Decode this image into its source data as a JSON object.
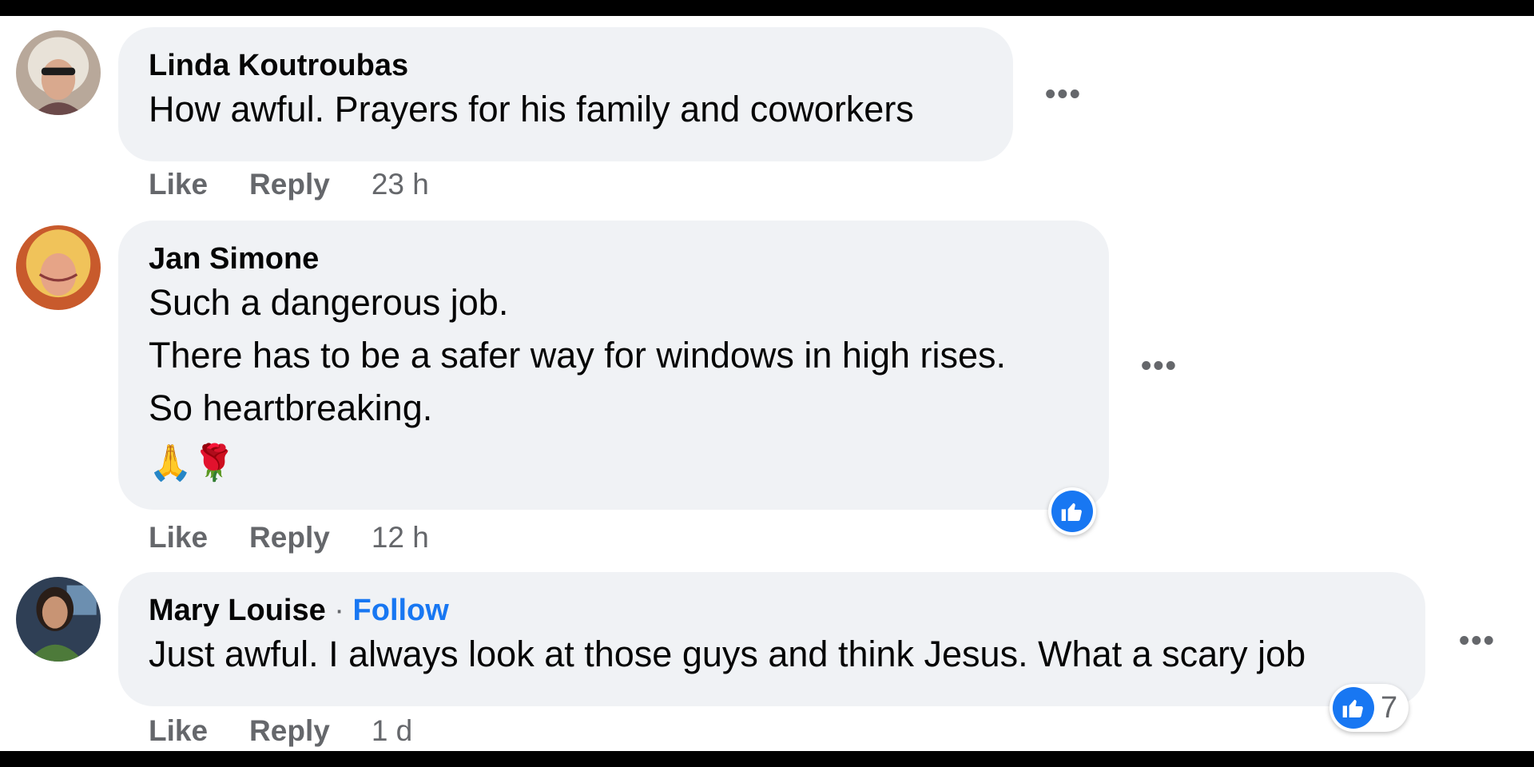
{
  "comments": [
    {
      "author": "Linda Koutroubas",
      "lines": [
        "How awful. Prayers for his family and coworkers"
      ],
      "like_label": "Like",
      "reply_label": "Reply",
      "time": "23 h",
      "more_label": "•••"
    },
    {
      "author": "Jan Simone",
      "lines": [
        "Such a dangerous job.",
        "There has to be a safer way for windows in high rises.",
        "So heartbreaking."
      ],
      "emoji": "🙏🌹",
      "like_label": "Like",
      "reply_label": "Reply",
      "time": "12 h",
      "more_label": "•••",
      "reaction_icon": "thumbs-up-icon"
    },
    {
      "author": "Mary Louise",
      "separator": " · ",
      "follow_label": "Follow",
      "lines": [
        "Just awful. I always look at those guys and think Jesus. What a scary job"
      ],
      "like_label": "Like",
      "reply_label": "Reply",
      "time": "1 d",
      "more_label": "•••",
      "reaction_icon": "thumbs-up-icon",
      "reaction_count": "7"
    }
  ],
  "colors": {
    "bubble": "#f0f2f5",
    "meta_text": "#65676b",
    "link": "#1877f2",
    "like_blue": "#1877f2"
  }
}
